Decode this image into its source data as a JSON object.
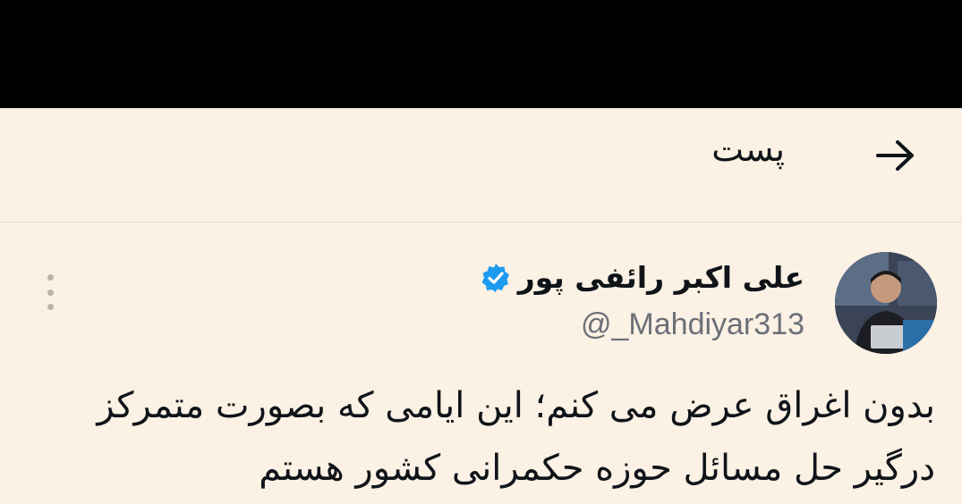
{
  "header": {
    "title": "پست",
    "back_icon": "arrow-right-icon"
  },
  "post": {
    "author": {
      "name": "علی اکبر رائفی پور",
      "handle": "@_Mahdiyar313",
      "verified_icon": "verified-badge-icon",
      "avatar_icon": "avatar"
    },
    "more_icon": "more-vertical-icon",
    "text_lines": [
      "بدون اغراق عرض می کنم؛ این ایامی که بصورت متمرکز",
      "درگیر حل مسائل حوزه حکمرانی کشور هستم"
    ]
  },
  "colors": {
    "background": "#fbf1e4",
    "verified": "#1d9bf0",
    "handle": "#6b7078",
    "top_bar": "#000000"
  }
}
